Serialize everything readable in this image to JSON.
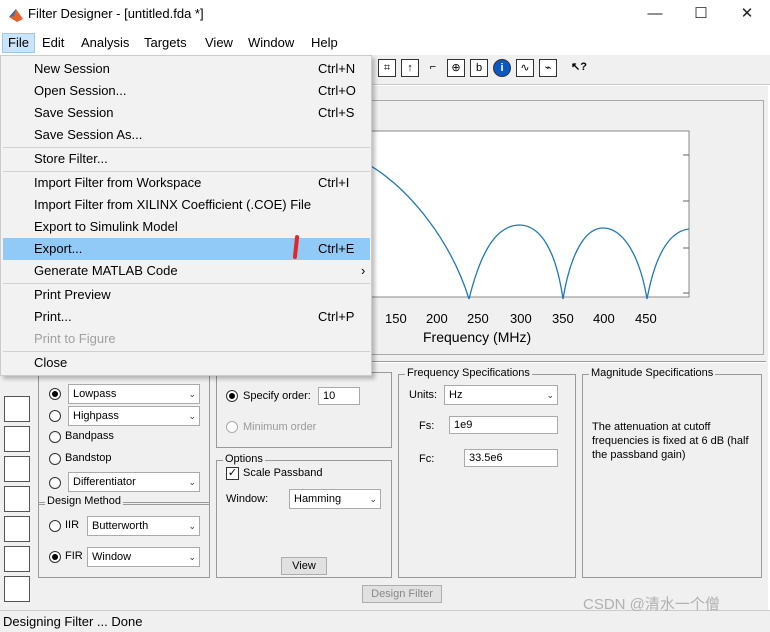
{
  "window": {
    "title": "Filter Designer -  [untitled.fda *]",
    "minimize": "—",
    "maximize": "☐",
    "close": "✕"
  },
  "menubar": [
    "File",
    "Edit",
    "Analysis",
    "Targets",
    "View",
    "Window",
    "Help"
  ],
  "file_menu": {
    "items": [
      {
        "label": "New Session",
        "shortcut": "Ctrl+N"
      },
      {
        "label": "Open Session...",
        "shortcut": "Ctrl+O"
      },
      {
        "label": "Save Session",
        "shortcut": "Ctrl+S"
      },
      {
        "label": "Save Session As...",
        "shortcut": ""
      },
      {
        "label": "Store Filter...",
        "shortcut": ""
      },
      {
        "label": "Import Filter from Workspace",
        "shortcut": "Ctrl+I"
      },
      {
        "label": "Import Filter from XILINX Coefficient (.COE) File",
        "shortcut": ""
      },
      {
        "label": "Export to Simulink Model",
        "shortcut": ""
      },
      {
        "label": "Export...",
        "shortcut": "Ctrl+E"
      },
      {
        "label": "Generate MATLAB Code",
        "shortcut": "›"
      },
      {
        "label": "Print Preview",
        "shortcut": ""
      },
      {
        "label": "Print...",
        "shortcut": "Ctrl+P"
      },
      {
        "label": "Print to Figure",
        "shortcut": ""
      },
      {
        "label": "Close",
        "shortcut": ""
      }
    ]
  },
  "plot": {
    "xlabel": "Frequency (MHz)",
    "ticks": [
      "150",
      "200",
      "250",
      "300",
      "350",
      "400",
      "450"
    ]
  },
  "response_type": {
    "options": [
      "Lowpass",
      "Highpass",
      "Bandpass",
      "Bandstop",
      "Differentiator"
    ]
  },
  "design_method": {
    "title": "Design Method",
    "iir_label": "IIR",
    "iir_value": "Butterworth",
    "fir_label": "FIR",
    "fir_value": "Window"
  },
  "order": {
    "specify_label": "Specify order:",
    "value": "10",
    "minimum_label": "Minimum order"
  },
  "options": {
    "title": "Options",
    "scale_label": "Scale Passband",
    "window_label": "Window:",
    "window_value": "Hamming",
    "view_button": "View"
  },
  "freq_specs": {
    "title": "Frequency Specifications",
    "units_label": "Units:",
    "units_value": "Hz",
    "fs_label": "Fs:",
    "fs_value": "1e9",
    "fc_label": "Fc:",
    "fc_value": "33.5e6"
  },
  "mag_specs": {
    "title": "Magnitude Specifications",
    "text": "The attenuation at cutoff frequencies is fixed at 6 dB (half the passband gain)"
  },
  "design_button": "Design Filter",
  "status": "Designing Filter ... Done",
  "watermark": "CSDN @清水一个僧"
}
